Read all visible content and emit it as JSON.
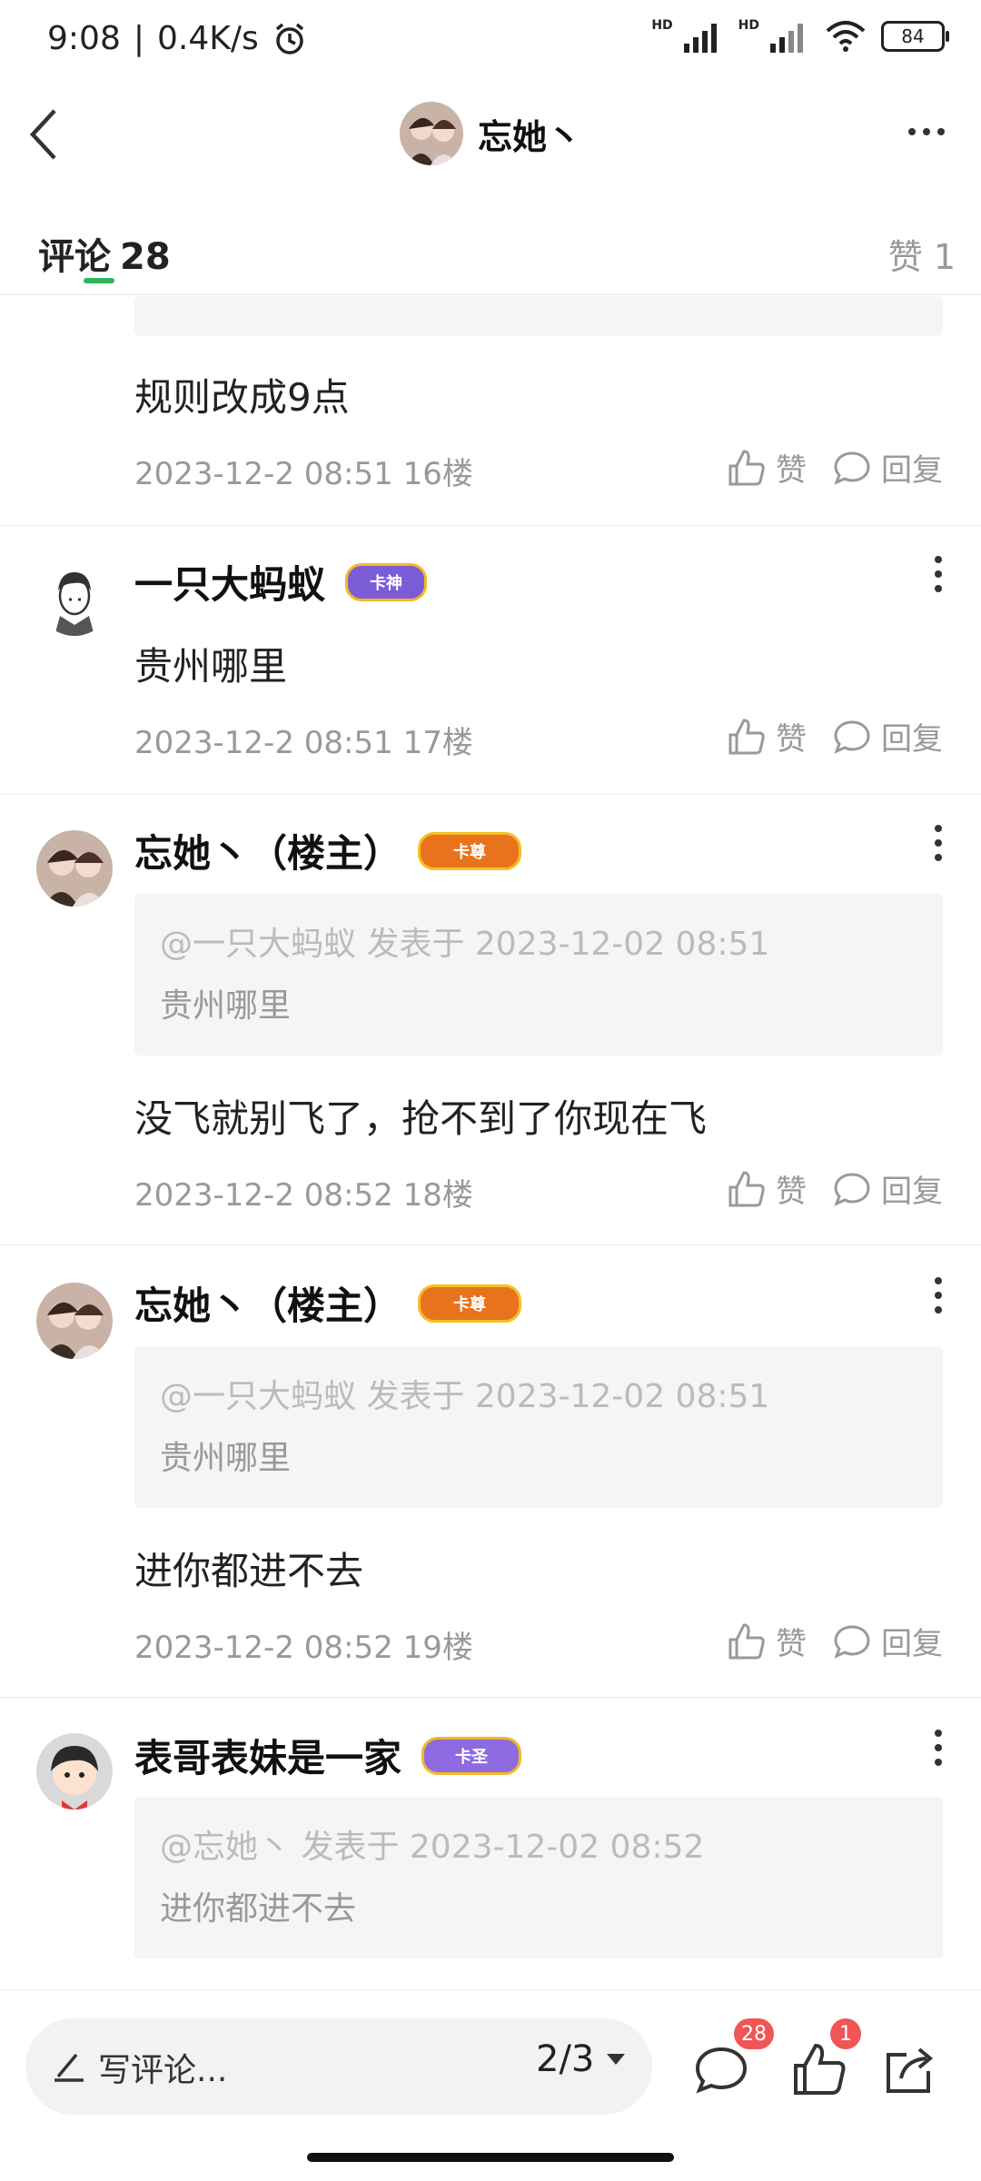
{
  "status": {
    "time": "9:08",
    "speed": "0.4K/s",
    "battery": "84",
    "hd1": "HD",
    "hd2": "HD"
  },
  "header": {
    "name": "忘她丶"
  },
  "tabs": {
    "comments_label": "评论",
    "comments_count": "28",
    "likes_label": "赞",
    "likes_count": "1"
  },
  "actions": {
    "like": "赞",
    "reply": "回复"
  },
  "comments": [
    {
      "text": "规则改成9点",
      "date": "2023-12-2 08:51",
      "floor": "16楼"
    },
    {
      "name": "一只大蚂蚁",
      "badge": "卡神",
      "text": "贵州哪里",
      "date": "2023-12-2 08:51",
      "floor": "17楼"
    },
    {
      "name": "忘她丶（楼主）",
      "badge": "卡尊",
      "quote_meta": "@一只大蚂蚁 发表于 2023-12-02 08:51",
      "quote_text": "贵州哪里",
      "text": "没飞就别飞了，抢不到了你现在飞",
      "date": "2023-12-2 08:52",
      "floor": "18楼"
    },
    {
      "name": "忘她丶（楼主）",
      "badge": "卡尊",
      "quote_meta": "@一只大蚂蚁 发表于 2023-12-02 08:51",
      "quote_text": "贵州哪里",
      "text": "进你都进不去",
      "date": "2023-12-2 08:52",
      "floor": "19楼"
    },
    {
      "name": "表哥表妹是一家",
      "badge": "卡圣",
      "quote_meta": "@忘她丶 发表于 2023-12-02 08:52",
      "quote_text": "进你都进不去"
    }
  ],
  "bottom": {
    "placeholder": "写评论...",
    "page": "2/3",
    "comment_badge": "28",
    "like_badge": "1"
  },
  "colors": {
    "accent": "#2fb55b",
    "badge_red": "#f05656",
    "badge_gold": "#e8a21c",
    "badge_purple": "#8e6be0"
  }
}
